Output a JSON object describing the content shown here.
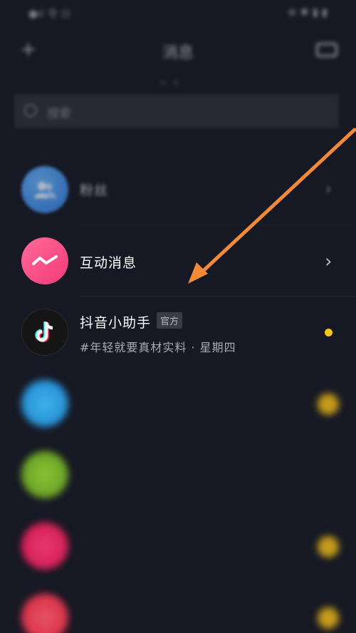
{
  "status_bar": {
    "left": "●ıl 令 ⊡",
    "right": "⊕ ✱ ▮ ▮"
  },
  "header": {
    "title": "消息"
  },
  "search": {
    "placeholder": "搜索"
  },
  "rows": {
    "fans": {
      "title": "粉丝"
    },
    "interact": {
      "title": "互动消息"
    },
    "helper": {
      "title": "抖音小助手",
      "badge": "官方",
      "subtitle": "#年轻就要真材实料 · 星期四"
    },
    "r4": {
      "title": "",
      "subtitle": ""
    },
    "r5": {
      "title": "",
      "subtitle": ""
    },
    "r6": {
      "title": "",
      "subtitle": ""
    },
    "r7": {
      "title": "",
      "subtitle": ""
    }
  },
  "colors": {
    "background": "#161823",
    "arrow": "#f28a3a",
    "unread_dot": "#f5c518",
    "interact_avatar": "#f23a78",
    "fans_avatar": "#2e7ee6"
  },
  "icons": {
    "plus": "plus-icon",
    "camera": "video-camera-icon",
    "search": "search-icon",
    "fans": "users-icon",
    "interact": "message-wave-icon",
    "helper": "tiktok-logo-icon",
    "chevron": "chevron-right-icon"
  }
}
